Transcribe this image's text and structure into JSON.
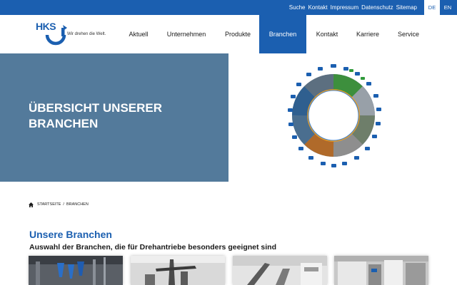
{
  "topbar": {
    "links": [
      "Suche",
      "Kontakt",
      "Impressum",
      "Datenschutz",
      "Sitemap"
    ],
    "languages": {
      "active": "DE",
      "inactive": "EN"
    }
  },
  "logo": {
    "brand": "HKS",
    "tagline": "Wir drehen die Welt."
  },
  "nav": {
    "items": [
      "Aktuell",
      "Unternehmen",
      "Produkte",
      "Branchen",
      "Kontakt",
      "Karriere",
      "Service"
    ],
    "active": "Branchen"
  },
  "hero": {
    "title": "ÜBERSICHT UNSERER BRANCHEN"
  },
  "breadcrumb": {
    "home": "STARTSEITE",
    "separator": "/",
    "current": "BRANCHEN"
  },
  "section": {
    "title": "Unsere Branchen",
    "subtitle": "Auswahl der Branchen, die für Drehantriebe besonders geeignet sind"
  },
  "colors": {
    "brand_blue": "#1b5fb0",
    "hero_panel": "#537a9b"
  },
  "icons": {
    "home": "home-icon",
    "logo": "hks-logo-mark-icon"
  }
}
